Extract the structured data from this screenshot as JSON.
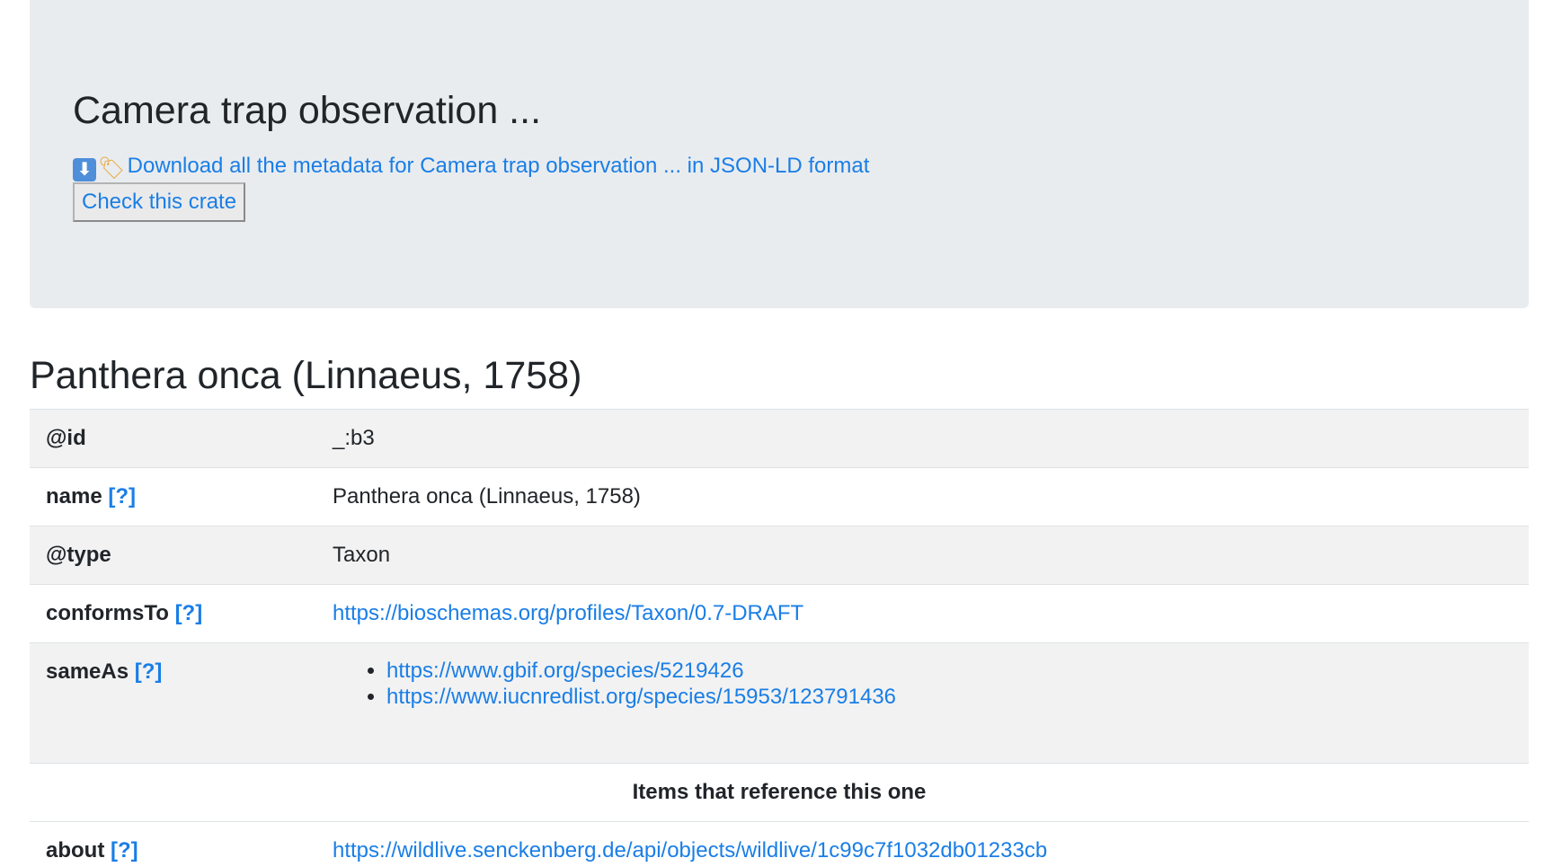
{
  "header": {
    "title": "Camera trap observation ...",
    "download": {
      "arrow_emoji": "⬇",
      "tag_emoji": "🏷",
      "link_text": "Download all the metadata for Camera trap observation ... in JSON-LD format"
    },
    "check_button_label": "Check this crate"
  },
  "entity": {
    "title": "Panthera onca (Linnaeus, 1758)",
    "help_label": "[?]",
    "rows": {
      "id": {
        "key": "@id",
        "value": "_:b3"
      },
      "name": {
        "key": "name",
        "value": "Panthera onca (Linnaeus, 1758)"
      },
      "type": {
        "key": "@type",
        "value": "Taxon"
      },
      "conformsTo": {
        "key": "conformsTo",
        "value": "https://bioschemas.org/profiles/Taxon/0.7-DRAFT"
      },
      "sameAs": {
        "key": "sameAs",
        "values": [
          "https://www.gbif.org/species/5219426",
          "https://www.iucnredlist.org/species/15953/123791436"
        ]
      }
    },
    "references_header": "Items that reference this one",
    "references": {
      "about": {
        "key": "about",
        "value": "https://wildlive.senckenberg.de/api/objects/wildlive/1c99c7f1032db01233cb"
      }
    }
  }
}
